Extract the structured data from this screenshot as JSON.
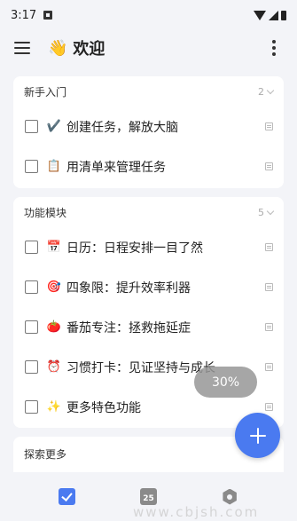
{
  "status_bar": {
    "time": "3:17"
  },
  "app_bar": {
    "title": "欢迎",
    "title_icon": "👋"
  },
  "sections": [
    {
      "title": "新手入门",
      "count": "2",
      "tasks": [
        {
          "icon": "✔️",
          "label": "创建任务，解放大脑"
        },
        {
          "icon": "📋",
          "label": "用清单来管理任务"
        }
      ]
    },
    {
      "title": "功能模块",
      "count": "5",
      "tasks": [
        {
          "icon": "📅",
          "label": "日历：日程安排一目了然"
        },
        {
          "icon": "🎯",
          "label": "四象限：提升效率利器"
        },
        {
          "icon": "🍅",
          "label": "番茄专注：拯救拖延症"
        },
        {
          "icon": "⏰",
          "label": "习惯打卡：见证坚持与成长"
        },
        {
          "icon": "✨",
          "label": "更多特色功能"
        }
      ]
    },
    {
      "title": "探索更多",
      "count": "",
      "tasks": []
    }
  ],
  "toast": {
    "text": "30%"
  },
  "bottom_nav": {
    "calendar_day": "25"
  },
  "watermark": "www.cbjsh.com",
  "colors": {
    "accent": "#4a7af0",
    "background": "#f3f4f8"
  }
}
